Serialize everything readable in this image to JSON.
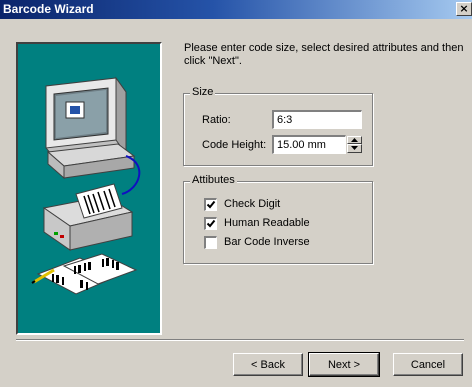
{
  "window": {
    "title": "Barcode Wizard",
    "close_glyph": "×"
  },
  "instructions": "Please enter code size, select desired attributes and then click \"Next\".",
  "size_group": {
    "legend": "Size",
    "ratio_label": "Ratio:",
    "ratio_value": "6:3",
    "code_height_label": "Code Height:",
    "code_height_value": "15.00 mm"
  },
  "attributes_group": {
    "legend": "Attibutes",
    "items": [
      {
        "label": "Check Digit",
        "checked": true
      },
      {
        "label": "Human Readable",
        "checked": true
      },
      {
        "label": "Bar Code Inverse",
        "checked": false
      }
    ]
  },
  "buttons": {
    "back": "< Back",
    "next": "Next >",
    "cancel": "Cancel"
  },
  "colors": {
    "title_bar_start": "#0a246a",
    "title_bar_end": "#a6caf0",
    "panel_background": "#008080",
    "dialog_background": "#d4d0c8"
  },
  "icons": {
    "illustration": "computer-printer-barcode-illustration",
    "spin_up": "spin-up-arrow-icon",
    "spin_down": "spin-down-arrow-icon",
    "check": "checkmark-icon"
  }
}
